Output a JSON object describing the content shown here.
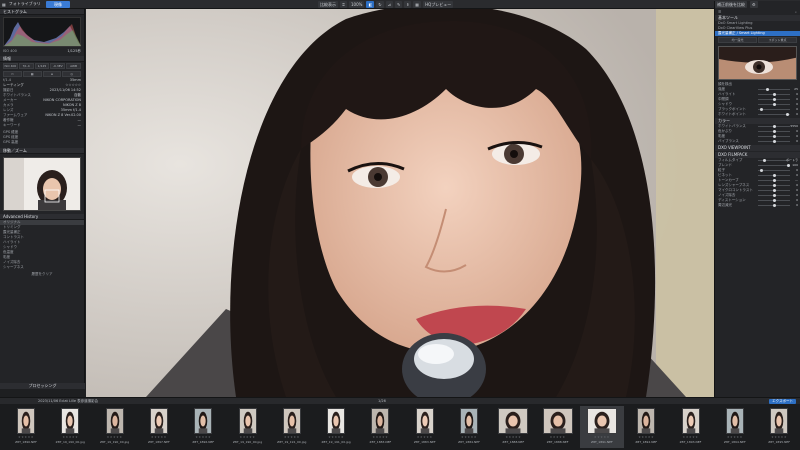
{
  "app": {
    "menu_label": "フォトライブラリ",
    "tab_active": "現像",
    "toolbar_compare": "比較表示",
    "toolbar_fit": "100%",
    "toolbar_hd": "HQプレビュー",
    "right_button": "補正前後を比較"
  },
  "left_panel": {
    "histogram_title": "ヒストグラム",
    "info_title": "情報",
    "exposure_rows": [
      {
        "label": "ISO 400",
        "value": "1/125秒"
      },
      {
        "label": "f/1.4",
        "value": "35mm"
      }
    ],
    "mode_buttons": [
      "ISO 400",
      "f/1.4",
      "1/125",
      "-0.3EV",
      "AWB"
    ],
    "meta_title": "レーティング",
    "meta_rows": [
      {
        "label": "撮影日",
        "value": "2023/11/06 14:52"
      },
      {
        "label": "ホワイトバランス",
        "value": "自動"
      },
      {
        "label": "メーカー",
        "value": "NIKON CORPORATION"
      },
      {
        "label": "カメラ",
        "value": "NIKON Z 8"
      },
      {
        "label": "レンズ",
        "value": "35mm f/1.4"
      },
      {
        "label": "ファームウェア",
        "value": "NIKON Z 8 Ver.02.00"
      },
      {
        "label": "著作権",
        "value": "—"
      },
      {
        "label": "キーワード",
        "value": "—"
      }
    ],
    "gps_rows": [
      {
        "label": "GPS 緯度",
        "value": ""
      },
      {
        "label": "GPS 経度",
        "value": ""
      },
      {
        "label": "GPS 高度",
        "value": ""
      }
    ],
    "navigator_title": "移動／ズーム",
    "history_title": "Advanced History",
    "history_items": [
      "オリジナル",
      "トリミング",
      "露光量補正",
      "コントラスト",
      "ハイライト",
      "シャドウ",
      "色温度",
      "彩度",
      "ノイズ除去",
      "シャープネス"
    ],
    "history_footer": "履歴をクリア",
    "export_button": "プロセッシング"
  },
  "right_panel": {
    "tools_title": "基本ツール",
    "presets": [
      "DxO Smart Lighting",
      "DxO ClearView Plus",
      "露光量補正 / Smart Lighting"
    ],
    "lighting_modes": [
      "均一露光",
      "スポット重点"
    ],
    "face_label": "顔を検出",
    "sliders": [
      {
        "label": "強度",
        "value": "25"
      },
      {
        "label": "ハイライト",
        "value": "0"
      },
      {
        "label": "中間調",
        "value": "0"
      },
      {
        "label": "シャドウ",
        "value": "0"
      },
      {
        "label": "ブラックポイント",
        "value": "0"
      },
      {
        "label": "ホワイトポイント",
        "value": "0"
      }
    ],
    "color_title": "カラー",
    "color_rows": [
      {
        "label": "ホワイトバランス",
        "value": "5550"
      },
      {
        "label": "色かぶり",
        "value": "0"
      },
      {
        "label": "彩度",
        "value": "0"
      },
      {
        "label": "バイブランス",
        "value": "0"
      }
    ],
    "viewpoint_title": "DXO VIEWPOINT",
    "filmpack_title": "DXO FILMPACK",
    "film_rows": [
      {
        "label": "フィルムタイプ",
        "value": "ポートラ"
      },
      {
        "label": "ブレンド",
        "value": "100"
      },
      {
        "label": "粒子",
        "value": "0"
      },
      {
        "label": "ビネット",
        "value": "0"
      },
      {
        "label": "トーンカーブ",
        "value": "—"
      },
      {
        "label": "レンズシャープネス",
        "value": "0"
      },
      {
        "label": "マイクロコントラスト",
        "value": "0"
      },
      {
        "label": "ノイズ除去",
        "value": "0"
      },
      {
        "label": "ディストーション",
        "value": "0"
      },
      {
        "label": "周辺減光",
        "value": "0"
      }
    ]
  },
  "filmstrip": {
    "path": "2023/11/06 Eclat Lille 表参道撮影会",
    "count": "1/26",
    "export_button": "エクスポート",
    "files": [
      "Z8T_1890.NEF",
      "Z8T_19_190_00.jpg",
      "Z8T_19_190_00.jpg",
      "Z8T_1897.NEF",
      "Z8T_1896.NEF",
      "Z8T_19_190_00.jpg",
      "Z8T_19_191_00.jpg",
      "Z8T_19_191_00.jpg",
      "Z8T_1883.NEF",
      "Z8T_1883.NEF",
      "Z8T_1884.NEF",
      "Z8T_1888.NEF",
      "Z8T_1888.NEF",
      "Z8T_1891.NEF",
      "Z8T_1892.NEF",
      "Z8T_1893.NEF",
      "Z8T_1894.NEF",
      "Z8T_1895.NEF"
    ],
    "stars": "★★★★★"
  }
}
